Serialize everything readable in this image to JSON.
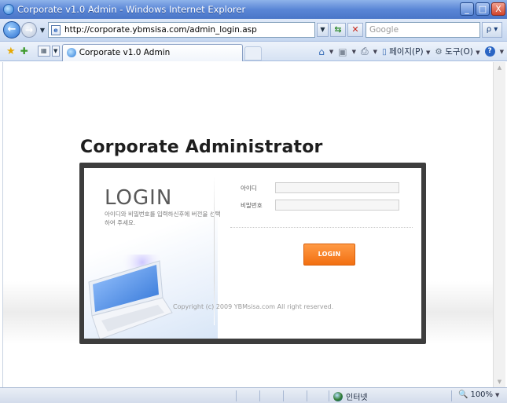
{
  "window": {
    "title": "Corporate v1.0 Admin - Windows Internet Explorer",
    "controls": {
      "minimize": "_",
      "maximize": "□",
      "close": "X"
    }
  },
  "addressbar": {
    "url": "http://corporate.ybmsisa.com/admin_login.asp",
    "search_placeholder": "Google",
    "search_button": "ρ ▾"
  },
  "tabbar": {
    "active_tab_label": "Corporate v1.0 Admin",
    "page_menu": "페이지(P)",
    "tools_menu": "도구(O)"
  },
  "page": {
    "heading": "Corporate Administrator",
    "login_title": "LOGIN",
    "login_description": "아이디와 비밀번호를 입력하신후에 버전을 선택하여 주세요.",
    "id_label": "아이디",
    "password_label": "비밀번호",
    "id_value": "",
    "password_value": "",
    "login_button": "LOGIN",
    "copyright": "Copyright (c) 2009 YBMsisa.com All right reserved."
  },
  "statusbar": {
    "zone": "인터넷",
    "zoom": "100%"
  },
  "colors": {
    "accent_orange": "#f26f11",
    "titlebar_blue": "#5a86d6",
    "panel_frame": "#3d3d3d"
  }
}
